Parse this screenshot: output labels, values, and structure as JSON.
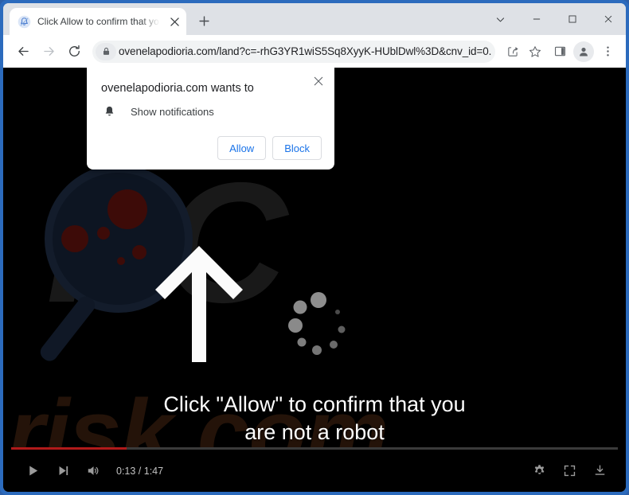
{
  "window": {
    "controls": {
      "tab_search_label": "Search tabs",
      "minimize_label": "Minimize",
      "maximize_label": "Maximize",
      "close_label": "Close"
    }
  },
  "tabstrip": {
    "tab": {
      "title": "Click Allow to confirm that you are not a robot",
      "favicon": "bell-icon",
      "close_label": "Close tab"
    },
    "new_tab_label": "New tab"
  },
  "toolbar": {
    "back_label": "Back",
    "forward_label": "Forward",
    "reload_label": "Reload",
    "lock_icon": "lock-icon",
    "url": "ovenelapodioria.com/land?c=-rhG3YR1wiS5Sq8XyyK-HUblDwl%3D&cnv_id=0...",
    "share_label": "Share this page",
    "bookmark_label": "Bookmark this tab",
    "side_panel_label": "Side panel",
    "profile_label": "Profile",
    "menu_label": "Customize and control Google Chrome"
  },
  "permission_dialog": {
    "title": "ovenelapodioria.com wants to",
    "permission_icon": "bell-icon",
    "permission_label": "Show notifications",
    "allow_label": "Allow",
    "block_label": "Block",
    "close_label": "Close"
  },
  "page": {
    "headline_line1": "Click \"Allow\" to confirm that you",
    "headline_line2": "are not a robot",
    "watermark_top": "PC",
    "watermark_bottom": "risk.com",
    "graphics": {
      "magnifier": "magnifier-icon",
      "arrow": "arrow-up-icon",
      "spinner": "loading-spinner-icon"
    }
  },
  "video_player": {
    "progress_percent": 19,
    "play_label": "Play",
    "next_label": "Next",
    "mute_label": "Mute",
    "time": "0:13 / 1:47",
    "settings_label": "Settings",
    "fullscreen_label": "Full screen",
    "download_label": "Download"
  },
  "colors": {
    "frame_blue": "#2c6bbd",
    "chrome_grey": "#dee1e6",
    "link_blue": "#1a73e8",
    "progress_red": "#b01a1a",
    "watermark_brown": "#241309"
  }
}
